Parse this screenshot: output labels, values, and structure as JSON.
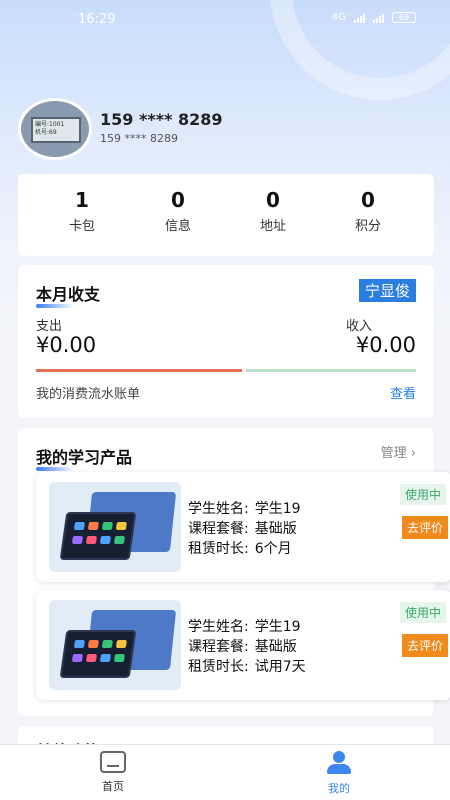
{
  "status_bar": {
    "time": "16:29",
    "network": "4G",
    "battery": "69"
  },
  "profile": {
    "phone": "159 **** 8289",
    "phone_sub": "159 **** 8289",
    "avatar_lines": [
      "编号:1001",
      "机号:69"
    ]
  },
  "stats": [
    {
      "value": "1",
      "label": "卡包"
    },
    {
      "value": "0",
      "label": "信息"
    },
    {
      "value": "0",
      "label": "地址"
    },
    {
      "value": "0",
      "label": "积分"
    }
  ],
  "finance": {
    "title": "本月收支",
    "name_tag": "宁显俊",
    "expense_label": "支出",
    "expense_amount": "¥0.00",
    "income_label": "收入",
    "income_amount": "¥0.00",
    "ledger_link": "我的消费流水账单",
    "view_link": "查看"
  },
  "products": {
    "title": "我的学习产品",
    "manage": "管理",
    "items": [
      {
        "name_label": "学生姓名:",
        "name": "学生19",
        "plan_label": "课程套餐:",
        "plan": "基础版",
        "duration_label": "租赁时长:",
        "duration": "6个月",
        "status": "使用中",
        "action": "去评价"
      },
      {
        "name_label": "学生姓名:",
        "name": "学生19",
        "plan_label": "课程套餐:",
        "plan": "基础版",
        "duration_label": "租赁时长:",
        "duration": "试用7天",
        "status": "使用中",
        "action": "去评价"
      }
    ]
  },
  "next_section": {
    "title": "其他功能"
  },
  "tabbar": {
    "items": [
      {
        "label": "首页",
        "icon": "home-icon",
        "active": false
      },
      {
        "label": "我的",
        "icon": "profile-icon",
        "active": true
      }
    ],
    "active_color": "#3b86f0"
  },
  "colors": {
    "accent": "#2a7de1",
    "expense_bar": "#e07052",
    "income_bar": "#bfe0c8",
    "eval_button": "#f08a1c",
    "status_green": "#3aa86a"
  }
}
